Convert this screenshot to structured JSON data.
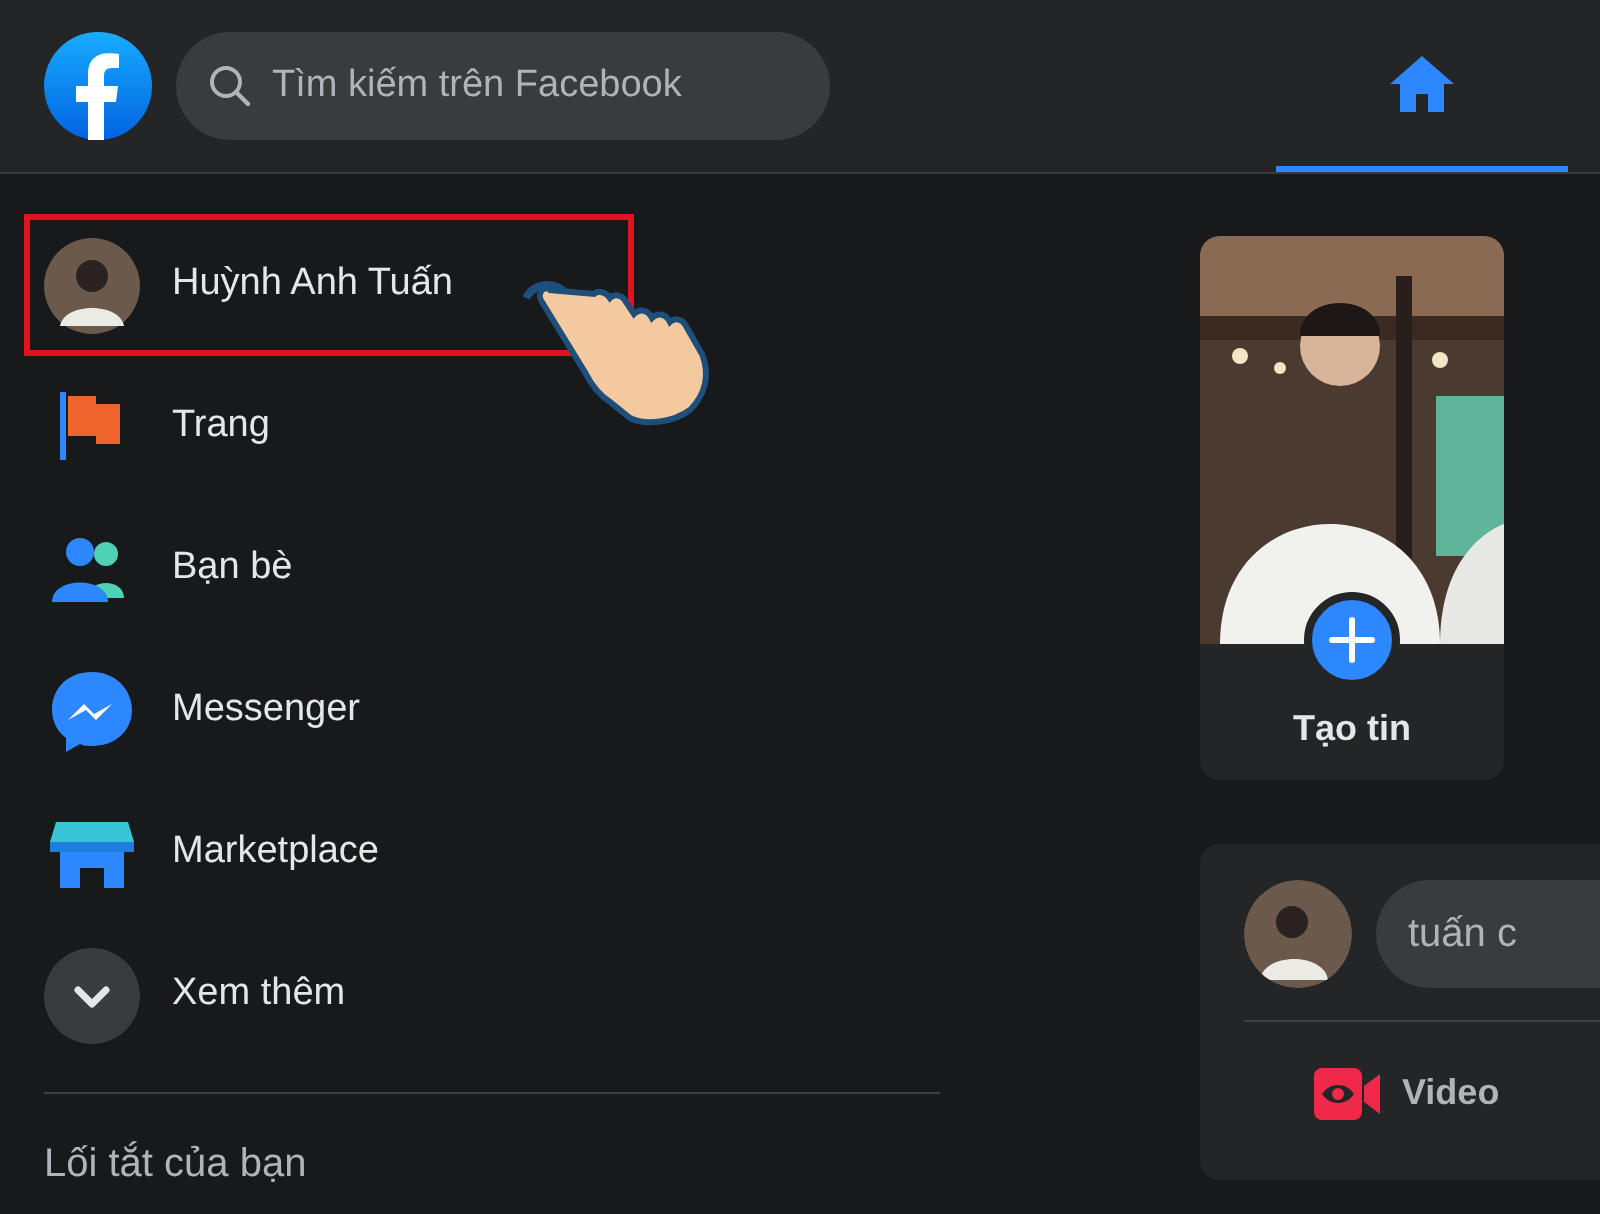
{
  "header": {
    "search": {
      "placeholder": "Tìm kiếm trên Facebook"
    },
    "tabs": [
      {
        "kind": "home",
        "selected": true
      }
    ]
  },
  "sidebar": {
    "items": [
      {
        "kind": "profile",
        "label": "Huỳnh Anh Tuấn",
        "highlighted": true
      },
      {
        "kind": "pages",
        "label": "Trang",
        "highlighted": false
      },
      {
        "kind": "friends",
        "label": "Bạn bè",
        "highlighted": false
      },
      {
        "kind": "messenger",
        "label": "Messenger",
        "highlighted": false
      },
      {
        "kind": "marketplace",
        "label": "Marketplace",
        "highlighted": false
      },
      {
        "kind": "more",
        "label": "Xem thêm",
        "highlighted": false
      }
    ],
    "section_title": "Lối tắt của bạn"
  },
  "stories": [
    {
      "kind": "create",
      "label": "Tạo tin"
    }
  ],
  "composer": {
    "placeholder": "tuấn c",
    "actions": [
      {
        "kind": "live-video",
        "label": "Video"
      }
    ]
  }
}
